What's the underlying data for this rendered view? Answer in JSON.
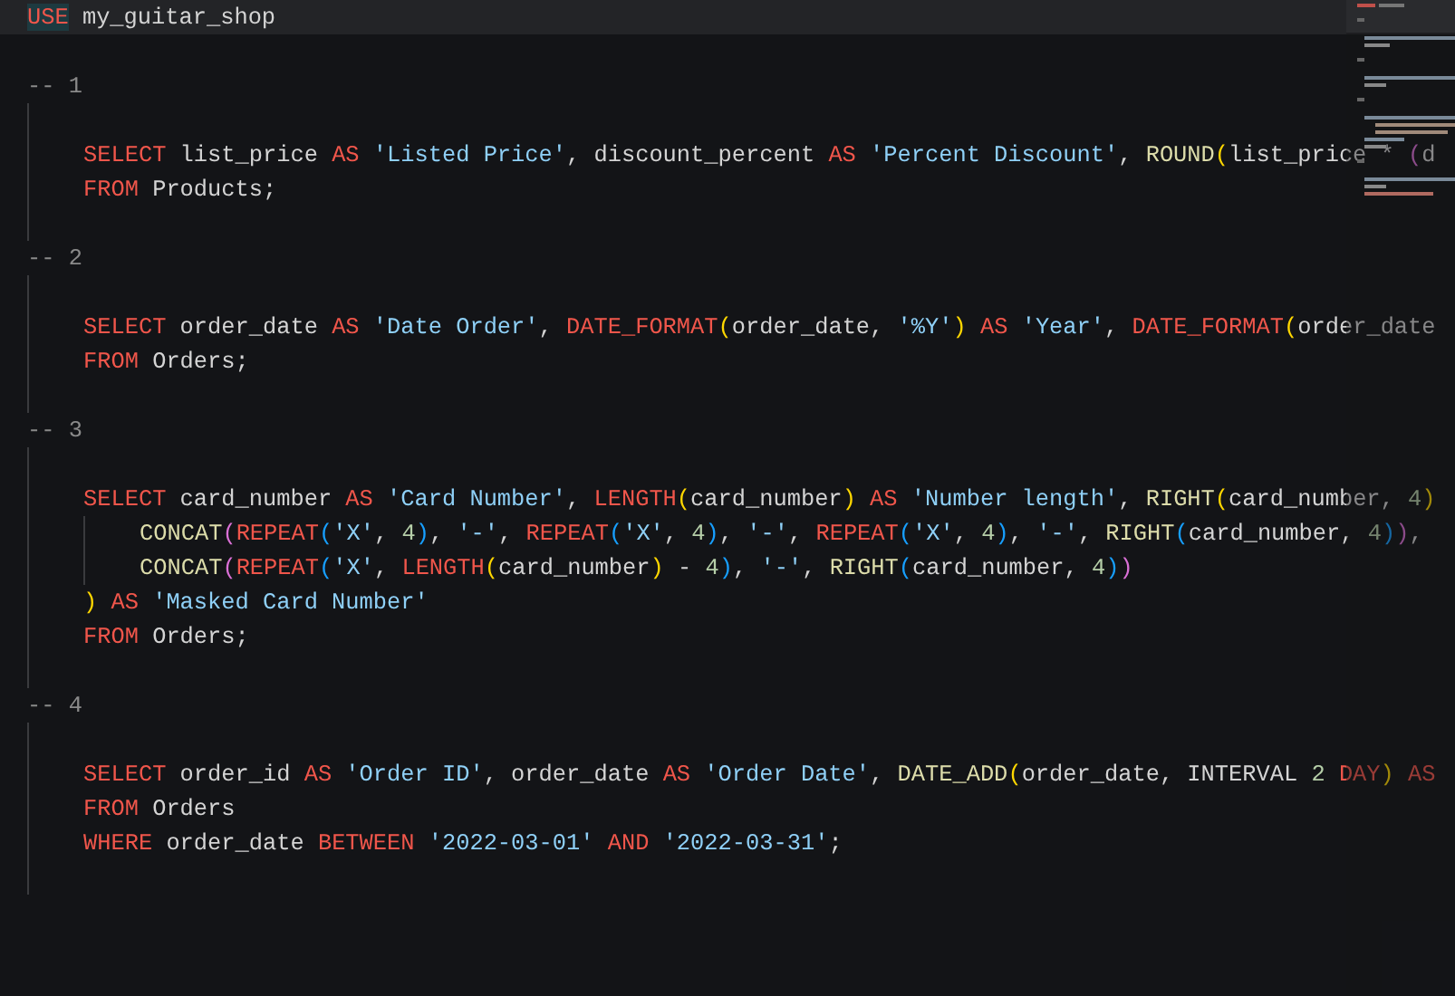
{
  "first_line": {
    "current": true,
    "tokens": [
      {
        "text": "USE",
        "kind": "kw",
        "highlighted": true
      },
      {
        "text": " my_guitar_shop",
        "kind": "id",
        "highlighted": false
      }
    ]
  },
  "sections": [
    {
      "comment": "-- 1",
      "lines": [
        {
          "tokens": [
            {
              "text": "SELECT",
              "kind": "kw"
            },
            {
              "text": " list_price ",
              "kind": "id"
            },
            {
              "text": "AS",
              "kind": "kw"
            },
            {
              "text": " 'Listed Price'",
              "kind": "str"
            },
            {
              "text": ", discount_percent ",
              "kind": "id"
            },
            {
              "text": "AS",
              "kind": "kw"
            },
            {
              "text": " 'Percent Discount'",
              "kind": "str"
            },
            {
              "text": ", ",
              "kind": "id"
            },
            {
              "text": "ROUND",
              "kind": "fn"
            },
            {
              "text": "(",
              "kind": "br1"
            },
            {
              "text": "list_price * ",
              "kind": "id"
            },
            {
              "text": "(",
              "kind": "br2"
            },
            {
              "text": "d",
              "kind": "id"
            }
          ]
        },
        {
          "tokens": [
            {
              "text": "FROM",
              "kind": "kw"
            },
            {
              "text": " Products;",
              "kind": "id"
            }
          ]
        }
      ]
    },
    {
      "comment": "-- 2",
      "lines": [
        {
          "tokens": [
            {
              "text": "SELECT",
              "kind": "kw"
            },
            {
              "text": " order_date ",
              "kind": "id"
            },
            {
              "text": "AS",
              "kind": "kw"
            },
            {
              "text": " 'Date Order'",
              "kind": "str"
            },
            {
              "text": ", ",
              "kind": "id"
            },
            {
              "text": "DATE_FORMAT",
              "kind": "kw"
            },
            {
              "text": "(",
              "kind": "br1"
            },
            {
              "text": "order_date, ",
              "kind": "id"
            },
            {
              "text": "'%Y'",
              "kind": "str"
            },
            {
              "text": ")",
              "kind": "br1"
            },
            {
              "text": " AS",
              "kind": "kw"
            },
            {
              "text": " 'Year'",
              "kind": "str"
            },
            {
              "text": ", ",
              "kind": "id"
            },
            {
              "text": "DATE_FORMAT",
              "kind": "kw"
            },
            {
              "text": "(",
              "kind": "br1"
            },
            {
              "text": "order_date",
              "kind": "id"
            }
          ]
        },
        {
          "tokens": [
            {
              "text": "FROM",
              "kind": "kw"
            },
            {
              "text": " Orders;",
              "kind": "id"
            }
          ]
        }
      ]
    },
    {
      "comment": "-- 3",
      "lines": [
        {
          "tokens": [
            {
              "text": "SELECT",
              "kind": "kw"
            },
            {
              "text": " card_number ",
              "kind": "id"
            },
            {
              "text": "AS",
              "kind": "kw"
            },
            {
              "text": " 'Card Number'",
              "kind": "str"
            },
            {
              "text": ", ",
              "kind": "id"
            },
            {
              "text": "LENGTH",
              "kind": "kw"
            },
            {
              "text": "(",
              "kind": "br1"
            },
            {
              "text": "card_number",
              "kind": "id"
            },
            {
              "text": ")",
              "kind": "br1"
            },
            {
              "text": " AS",
              "kind": "kw"
            },
            {
              "text": " 'Number length'",
              "kind": "str"
            },
            {
              "text": ", ",
              "kind": "id"
            },
            {
              "text": "RIGHT",
              "kind": "fn"
            },
            {
              "text": "(",
              "kind": "br1"
            },
            {
              "text": "card_number, ",
              "kind": "id"
            },
            {
              "text": "4",
              "kind": "num"
            },
            {
              "text": ")",
              "kind": "br1"
            }
          ],
          "children": [
            {
              "tokens": [
                {
                  "text": "CONCAT",
                  "kind": "fn"
                },
                {
                  "text": "(",
                  "kind": "br2"
                },
                {
                  "text": "REPEAT",
                  "kind": "kw"
                },
                {
                  "text": "(",
                  "kind": "br3"
                },
                {
                  "text": "'X'",
                  "kind": "str"
                },
                {
                  "text": ", ",
                  "kind": "id"
                },
                {
                  "text": "4",
                  "kind": "num"
                },
                {
                  "text": ")",
                  "kind": "br3"
                },
                {
                  "text": ", ",
                  "kind": "id"
                },
                {
                  "text": "'-'",
                  "kind": "str"
                },
                {
                  "text": ", ",
                  "kind": "id"
                },
                {
                  "text": "REPEAT",
                  "kind": "kw"
                },
                {
                  "text": "(",
                  "kind": "br3"
                },
                {
                  "text": "'X'",
                  "kind": "str"
                },
                {
                  "text": ", ",
                  "kind": "id"
                },
                {
                  "text": "4",
                  "kind": "num"
                },
                {
                  "text": ")",
                  "kind": "br3"
                },
                {
                  "text": ", ",
                  "kind": "id"
                },
                {
                  "text": "'-'",
                  "kind": "str"
                },
                {
                  "text": ", ",
                  "kind": "id"
                },
                {
                  "text": "REPEAT",
                  "kind": "kw"
                },
                {
                  "text": "(",
                  "kind": "br3"
                },
                {
                  "text": "'X'",
                  "kind": "str"
                },
                {
                  "text": ", ",
                  "kind": "id"
                },
                {
                  "text": "4",
                  "kind": "num"
                },
                {
                  "text": ")",
                  "kind": "br3"
                },
                {
                  "text": ", ",
                  "kind": "id"
                },
                {
                  "text": "'-'",
                  "kind": "str"
                },
                {
                  "text": ", ",
                  "kind": "id"
                },
                {
                  "text": "RIGHT",
                  "kind": "fn"
                },
                {
                  "text": "(",
                  "kind": "br3"
                },
                {
                  "text": "card_number, ",
                  "kind": "id"
                },
                {
                  "text": "4",
                  "kind": "num"
                },
                {
                  "text": ")",
                  "kind": "br3"
                },
                {
                  "text": ")",
                  "kind": "br2"
                },
                {
                  "text": ",",
                  "kind": "id"
                }
              ]
            },
            {
              "tokens": [
                {
                  "text": "CONCAT",
                  "kind": "fn"
                },
                {
                  "text": "(",
                  "kind": "br2"
                },
                {
                  "text": "REPEAT",
                  "kind": "kw"
                },
                {
                  "text": "(",
                  "kind": "br3"
                },
                {
                  "text": "'X'",
                  "kind": "str"
                },
                {
                  "text": ", ",
                  "kind": "id"
                },
                {
                  "text": "LENGTH",
                  "kind": "kw"
                },
                {
                  "text": "(",
                  "kind": "br1"
                },
                {
                  "text": "card_number",
                  "kind": "id"
                },
                {
                  "text": ")",
                  "kind": "br1"
                },
                {
                  "text": " - ",
                  "kind": "id"
                },
                {
                  "text": "4",
                  "kind": "num"
                },
                {
                  "text": ")",
                  "kind": "br3"
                },
                {
                  "text": ", ",
                  "kind": "id"
                },
                {
                  "text": "'-'",
                  "kind": "str"
                },
                {
                  "text": ", ",
                  "kind": "id"
                },
                {
                  "text": "RIGHT",
                  "kind": "fn"
                },
                {
                  "text": "(",
                  "kind": "br3"
                },
                {
                  "text": "card_number, ",
                  "kind": "id"
                },
                {
                  "text": "4",
                  "kind": "num"
                },
                {
                  "text": ")",
                  "kind": "br3"
                },
                {
                  "text": ")",
                  "kind": "br2"
                }
              ]
            }
          ]
        },
        {
          "tokens": [
            {
              "text": ")",
              "kind": "br1"
            },
            {
              "text": " AS",
              "kind": "kw"
            },
            {
              "text": " 'Masked Card Number'",
              "kind": "str"
            }
          ]
        },
        {
          "tokens": [
            {
              "text": "FROM",
              "kind": "kw"
            },
            {
              "text": " Orders;",
              "kind": "id"
            }
          ]
        }
      ]
    },
    {
      "comment": "-- 4",
      "lines": [
        {
          "tokens": [
            {
              "text": "SELECT",
              "kind": "kw"
            },
            {
              "text": " order_id ",
              "kind": "id"
            },
            {
              "text": "AS",
              "kind": "kw"
            },
            {
              "text": " 'Order ID'",
              "kind": "str"
            },
            {
              "text": ", order_date ",
              "kind": "id"
            },
            {
              "text": "AS",
              "kind": "kw"
            },
            {
              "text": " 'Order Date'",
              "kind": "str"
            },
            {
              "text": ", ",
              "kind": "id"
            },
            {
              "text": "DATE_ADD",
              "kind": "fn"
            },
            {
              "text": "(",
              "kind": "br1"
            },
            {
              "text": "order_date, INTERVAL ",
              "kind": "id"
            },
            {
              "text": "2",
              "kind": "num"
            },
            {
              "text": " DAY",
              "kind": "kw"
            },
            {
              "text": ")",
              "kind": "br1"
            },
            {
              "text": " AS",
              "kind": "kw"
            }
          ]
        },
        {
          "tokens": [
            {
              "text": "FROM",
              "kind": "kw"
            },
            {
              "text": " Orders",
              "kind": "id"
            }
          ]
        },
        {
          "tokens": [
            {
              "text": "WHERE",
              "kind": "kw"
            },
            {
              "text": " order_date ",
              "kind": "id"
            },
            {
              "text": "BETWEEN",
              "kind": "kw"
            },
            {
              "text": " '2022-03-01'",
              "kind": "str"
            },
            {
              "text": " AND",
              "kind": "kw"
            },
            {
              "text": " '2022-03-31'",
              "kind": "str"
            },
            {
              "text": ";",
              "kind": "id"
            }
          ]
        }
      ]
    }
  ]
}
